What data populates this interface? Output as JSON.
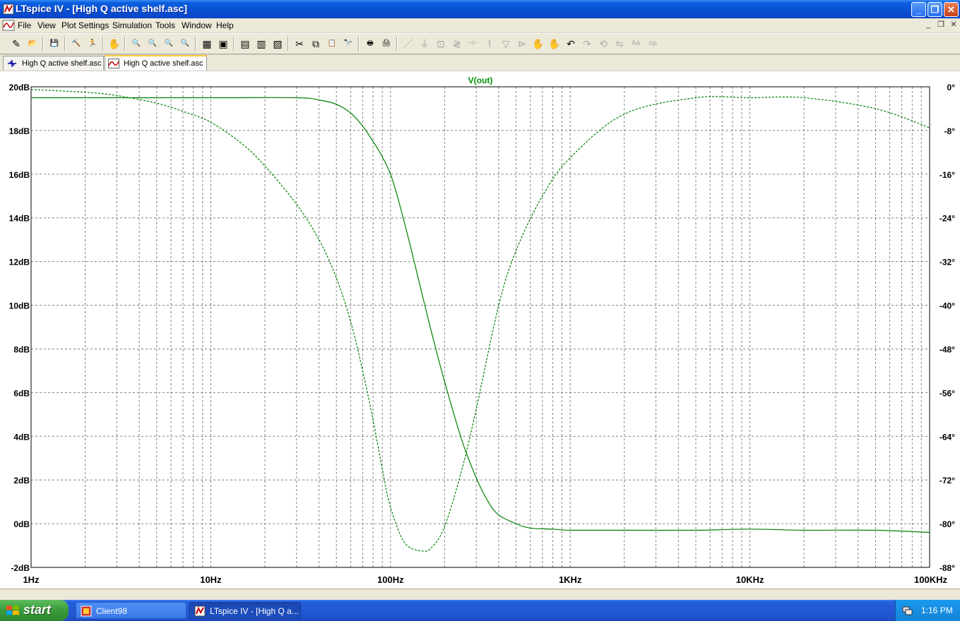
{
  "window": {
    "title": "LTspice IV - [High Q active shelf.asc]"
  },
  "menu": {
    "items": [
      "File",
      "View",
      "Plot Settings",
      "Simulation",
      "Tools",
      "Window",
      "Help"
    ]
  },
  "toolbar": {
    "buttons": [
      {
        "name": "new-schematic-icon",
        "glyph": "✎",
        "enabled": true
      },
      {
        "name": "open-icon",
        "glyph": "📂",
        "enabled": true
      },
      {
        "name": "save-icon",
        "glyph": "💾",
        "enabled": true
      },
      {
        "name": "control-panel-icon",
        "glyph": "🔨",
        "enabled": true
      },
      {
        "name": "run-icon",
        "glyph": "🏃",
        "enabled": true
      },
      {
        "name": "pan-icon",
        "glyph": "✋",
        "enabled": false
      },
      {
        "name": "zoom-in-icon",
        "glyph": "🔍",
        "enabled": true
      },
      {
        "name": "zoom-out-icon",
        "glyph": "🔍",
        "enabled": true
      },
      {
        "name": "zoom-back-icon",
        "glyph": "🔍",
        "enabled": true
      },
      {
        "name": "zoom-fit-icon",
        "glyph": "🔍",
        "enabled": true
      },
      {
        "name": "autorange-icon",
        "glyph": "▦",
        "enabled": true
      },
      {
        "name": "mark-unref-icon",
        "glyph": "▣",
        "enabled": true
      },
      {
        "name": "tile-horizontal-icon",
        "glyph": "▤",
        "enabled": true
      },
      {
        "name": "cascade-icon",
        "glyph": "▥",
        "enabled": true
      },
      {
        "name": "tile-vertical-icon",
        "glyph": "▧",
        "enabled": true
      },
      {
        "name": "cut-icon",
        "glyph": "✂",
        "enabled": true
      },
      {
        "name": "copy-icon",
        "glyph": "⧉",
        "enabled": true
      },
      {
        "name": "paste-icon",
        "glyph": "📋",
        "enabled": true
      },
      {
        "name": "find-icon",
        "glyph": "🔭",
        "enabled": true
      },
      {
        "name": "print-setup-icon",
        "glyph": "🖶",
        "enabled": true
      },
      {
        "name": "print-icon",
        "glyph": "🖨",
        "enabled": true
      },
      {
        "name": "wire-icon",
        "glyph": "／",
        "enabled": false
      },
      {
        "name": "ground-icon",
        "glyph": "⏚",
        "enabled": false
      },
      {
        "name": "label-net-icon",
        "glyph": "⊡",
        "enabled": false
      },
      {
        "name": "resistor-icon",
        "glyph": "≷",
        "enabled": false
      },
      {
        "name": "capacitor-icon",
        "glyph": "⊣⊢",
        "enabled": false
      },
      {
        "name": "inductor-icon",
        "glyph": "⌇",
        "enabled": false
      },
      {
        "name": "diode-icon",
        "glyph": "▽",
        "enabled": false
      },
      {
        "name": "component-icon",
        "glyph": "⊳",
        "enabled": false
      },
      {
        "name": "move-icon",
        "glyph": "✋",
        "enabled": false
      },
      {
        "name": "drag-icon",
        "glyph": "✋",
        "enabled": false
      },
      {
        "name": "undo-icon",
        "glyph": "↶",
        "enabled": true
      },
      {
        "name": "redo-icon",
        "glyph": "↷",
        "enabled": false
      },
      {
        "name": "rotate-icon",
        "glyph": "⟲",
        "enabled": false
      },
      {
        "name": "mirror-icon",
        "glyph": "⇋",
        "enabled": false
      },
      {
        "name": "text-icon",
        "glyph": "Aa",
        "enabled": false
      },
      {
        "name": "spice-directive-icon",
        "glyph": ".op",
        "enabled": false
      }
    ]
  },
  "tabs": [
    {
      "label": "High Q active shelf.asc",
      "kind": "schematic",
      "active": false
    },
    {
      "label": "High Q active shelf.asc",
      "kind": "waveform",
      "active": true
    }
  ],
  "chart_data": {
    "type": "line",
    "title": "V(out)",
    "x_scale": "log",
    "xlim": [
      1,
      100000
    ],
    "x_ticks": [
      "1Hz",
      "10Hz",
      "100Hz",
      "1KHz",
      "10KHz",
      "100KHz"
    ],
    "ylim_left": [
      -2,
      20
    ],
    "y_ticks_left": [
      "20dB",
      "18dB",
      "16dB",
      "14dB",
      "12dB",
      "10dB",
      "8dB",
      "6dB",
      "4dB",
      "2dB",
      "0dB",
      "-2dB"
    ],
    "ylim_right": [
      -88,
      0
    ],
    "y_ticks_right": [
      "0°",
      "-8°",
      "-16°",
      "-24°",
      "-32°",
      "-40°",
      "-48°",
      "-56°",
      "-64°",
      "-72°",
      "-80°",
      "-88°"
    ],
    "grid": true,
    "series": [
      {
        "name": "magnitude",
        "axis": "left",
        "unit": "dB",
        "style": "solid",
        "color": "#008000",
        "x": [
          1,
          10,
          30,
          40,
          50,
          60,
          70,
          80,
          90,
          100,
          110,
          130,
          150,
          170,
          200,
          250,
          300,
          350,
          400,
          500,
          600,
          800,
          1000,
          2000,
          5000,
          10000,
          20000,
          50000,
          100000
        ],
        "y": [
          19.5,
          19.5,
          19.5,
          19.4,
          19.2,
          18.8,
          18.2,
          17.5,
          16.8,
          16.0,
          14.9,
          12.6,
          10.5,
          8.7,
          6.5,
          3.8,
          2.1,
          1.0,
          0.4,
          0.0,
          -0.2,
          -0.25,
          -0.3,
          -0.3,
          -0.3,
          -0.25,
          -0.3,
          -0.3,
          -0.4
        ]
      },
      {
        "name": "phase",
        "axis": "right",
        "unit": "°",
        "style": "dashed",
        "color": "#008000",
        "x": [
          1,
          2,
          3,
          5,
          7,
          10,
          15,
          20,
          30,
          40,
          50,
          60,
          70,
          80,
          90,
          100,
          120,
          150,
          170,
          200,
          250,
          300,
          400,
          500,
          700,
          1000,
          2000,
          5000,
          10000,
          20000,
          50000,
          100000
        ],
        "y": [
          -0.5,
          -1.0,
          -1.6,
          -3.0,
          -4.5,
          -6.5,
          -10.5,
          -14.5,
          -21.5,
          -28.0,
          -35.0,
          -43.0,
          -52.0,
          -61.0,
          -70.0,
          -77.0,
          -83.5,
          -85.0,
          -84.3,
          -80.5,
          -70.0,
          -59.0,
          -40.0,
          -30.0,
          -20.0,
          -13.0,
          -5.0,
          -2.0,
          -2.0,
          -2.0,
          -4.0,
          -7.5
        ]
      }
    ]
  },
  "taskbar": {
    "start_label": "start",
    "buttons": [
      {
        "label": "Client98",
        "active": false
      },
      {
        "label": "LTspice IV - [High Q a...",
        "active": true
      }
    ],
    "clock": "1:16 PM"
  }
}
